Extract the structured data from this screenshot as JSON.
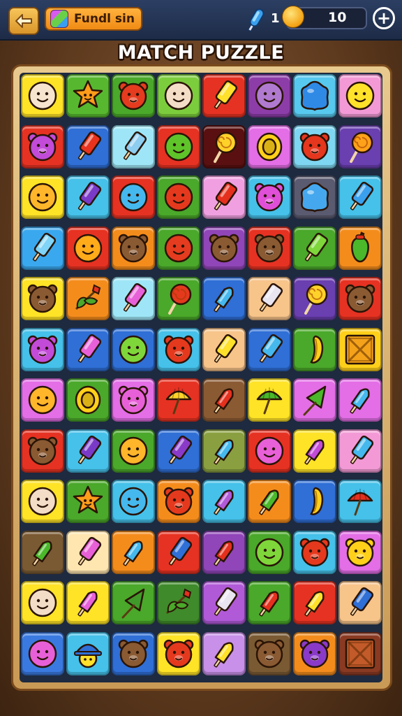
{
  "header": {
    "level_label": "Fundl sin",
    "rocket_count": "1",
    "coin_count": "10",
    "plus_symbol": "+"
  },
  "title": "MATCH PUZZLE",
  "board": {
    "rows": [
      [
        {
          "bg": "#ffe326",
          "icon": "face",
          "color": "#f6e4cf"
        },
        {
          "bg": "#57b82f",
          "icon": "star",
          "color": "#ff9c1a"
        },
        {
          "bg": "#4aa82a",
          "icon": "bear",
          "color": "#e53b1f"
        },
        {
          "bg": "#7ccd3d",
          "icon": "face",
          "color": "#f3ddc7"
        },
        {
          "bg": "#e63222",
          "icon": "pop",
          "color": "#ffe02a"
        },
        {
          "bg": "#8d3da8",
          "icon": "face",
          "color": "#b07ad0"
        },
        {
          "bg": "#57c8ee",
          "icon": "gem",
          "color": "#2f8ae6"
        },
        {
          "bg": "#f39ad6",
          "icon": "face",
          "color": "#ffe22a"
        }
      ],
      [
        {
          "bg": "#e63222",
          "icon": "bear",
          "color": "#c24bd8"
        },
        {
          "bg": "#2f6fd6",
          "icon": "pop",
          "color": "#e8331e"
        },
        {
          "bg": "#9ee6f7",
          "icon": "pop",
          "color": "#8ccdf0"
        },
        {
          "bg": "#e63222",
          "icon": "face",
          "color": "#5ec42a"
        },
        {
          "bg": "#5a1010",
          "icon": "lolly",
          "color": "#ffd22a"
        },
        {
          "bg": "#e36ee6",
          "icon": "ring",
          "color": "#ffd01a"
        },
        {
          "bg": "#7ed6f2",
          "icon": "bear",
          "color": "#e5361e"
        },
        {
          "bg": "#6a3fb0",
          "icon": "lolly",
          "color": "#ffa21a"
        }
      ],
      [
        {
          "bg": "#ffe326",
          "icon": "face",
          "color": "#ffb62a"
        },
        {
          "bg": "#45c1ea",
          "icon": "pop",
          "color": "#7a3ac8"
        },
        {
          "bg": "#e63222",
          "icon": "face",
          "color": "#45b8ee"
        },
        {
          "bg": "#4aa82a",
          "icon": "face",
          "color": "#e5391e"
        },
        {
          "bg": "#f0a0e0",
          "icon": "pop",
          "color": "#e5301e"
        },
        {
          "bg": "#45c1ea",
          "icon": "bear",
          "color": "#e04fd8"
        },
        {
          "bg": "#5a5a70",
          "icon": "gem",
          "color": "#45a8ee"
        },
        {
          "bg": "#45c1ea",
          "icon": "pop",
          "color": "#3aa0ee"
        }
      ],
      [
        {
          "bg": "#3aa8ee",
          "icon": "pop",
          "color": "#7fd4f7"
        },
        {
          "bg": "#e63222",
          "icon": "face",
          "color": "#ffab1a"
        },
        {
          "bg": "#f48c1c",
          "icon": "bear",
          "color": "#8a5a33"
        },
        {
          "bg": "#4aa82a",
          "icon": "face",
          "color": "#e53b1f"
        },
        {
          "bg": "#9045b8",
          "icon": "bear",
          "color": "#8a5a33"
        },
        {
          "bg": "#e63222",
          "icon": "bear",
          "color": "#8a5a33"
        },
        {
          "bg": "#4aa82a",
          "icon": "pop",
          "color": "#7ed63a"
        },
        {
          "bg": "#f48c1c",
          "icon": "pepper",
          "color": "#4ab82a"
        }
      ],
      [
        {
          "bg": "#ffe326",
          "icon": "bear",
          "color": "#8a5a33"
        },
        {
          "bg": "#f48c1c",
          "icon": "leaf",
          "color": "#4aa82a"
        },
        {
          "bg": "#9ee6f7",
          "icon": "pop",
          "color": "#e860d8"
        },
        {
          "bg": "#4aa82a",
          "icon": "lolly",
          "color": "#e5391e"
        },
        {
          "bg": "#2f6fd6",
          "icon": "rocketpop",
          "color": "#45b8ee"
        },
        {
          "bg": "#f7c48a",
          "icon": "pop",
          "color": "#e8e4f0"
        },
        {
          "bg": "#6a3fb0",
          "icon": "lolly",
          "color": "#ffd22a"
        },
        {
          "bg": "#e63222",
          "icon": "bear",
          "color": "#8a5a33"
        }
      ],
      [
        {
          "bg": "#45c1ea",
          "icon": "bear",
          "color": "#c24bd8"
        },
        {
          "bg": "#2f6fd6",
          "icon": "pop",
          "color": "#e860d8"
        },
        {
          "bg": "#2f6fd6",
          "icon": "face",
          "color": "#7ed63a"
        },
        {
          "bg": "#45c1ea",
          "icon": "bear",
          "color": "#e5391e"
        },
        {
          "bg": "#f7c48a",
          "icon": "pop",
          "color": "#ffe02a"
        },
        {
          "bg": "#2f6fd6",
          "icon": "pop",
          "color": "#45b8ee"
        },
        {
          "bg": "#4aa82a",
          "icon": "banana",
          "color": "#ffd01a"
        },
        {
          "bg": "#ffd01a",
          "icon": "crate",
          "color": "#f4a21a"
        }
      ],
      [
        {
          "bg": "#e36ee6",
          "icon": "face",
          "color": "#ffb62a"
        },
        {
          "bg": "#4aa82a",
          "icon": "ring",
          "color": "#ffd01a"
        },
        {
          "bg": "#e36ee6",
          "icon": "bear",
          "color": "#e860d8"
        },
        {
          "bg": "#e63222",
          "icon": "umbrella",
          "color": "#ffd22a"
        },
        {
          "bg": "#8a5a33",
          "icon": "rocketpop",
          "color": "#e5301e"
        },
        {
          "bg": "#ffe326",
          "icon": "umbrella",
          "color": "#4ab82a"
        },
        {
          "bg": "#e36ee6",
          "icon": "cone",
          "color": "#4ab82a"
        },
        {
          "bg": "#e36ee6",
          "icon": "rocketpop",
          "color": "#45b8ee"
        }
      ],
      [
        {
          "bg": "#e63222",
          "icon": "bear",
          "color": "#8a5a33"
        },
        {
          "bg": "#45c1ea",
          "icon": "pop",
          "color": "#7a3ac8"
        },
        {
          "bg": "#4aa82a",
          "icon": "face",
          "color": "#ffb62a"
        },
        {
          "bg": "#2f6fd6",
          "icon": "pop",
          "color": "#8a3ac8"
        },
        {
          "bg": "#8aa040",
          "icon": "rocketpop",
          "color": "#45b8ee"
        },
        {
          "bg": "#e63222",
          "icon": "face",
          "color": "#e860d8"
        },
        {
          "bg": "#ffe326",
          "icon": "rocketpop",
          "color": "#c24bd8"
        },
        {
          "bg": "#f39ad6",
          "icon": "pop",
          "color": "#45b8ee"
        }
      ],
      [
        {
          "bg": "#ffe326",
          "icon": "face",
          "color": "#f3ddc7"
        },
        {
          "bg": "#4aa82a",
          "icon": "star",
          "color": "#ff9c1a"
        },
        {
          "bg": "#45c1ea",
          "icon": "face",
          "color": "#45b8ee"
        },
        {
          "bg": "#f48c1c",
          "icon": "bear",
          "color": "#e5391e"
        },
        {
          "bg": "#45c1ea",
          "icon": "rocketpop",
          "color": "#b05ad8"
        },
        {
          "bg": "#f48c1c",
          "icon": "rocketpop",
          "color": "#4ab82a"
        },
        {
          "bg": "#2f6fd6",
          "icon": "banana",
          "color": "#ffd01a"
        },
        {
          "bg": "#45c1ea",
          "icon": "umbrella",
          "color": "#e5301e"
        }
      ],
      [
        {
          "bg": "#7a5a33",
          "icon": "rocketpop",
          "color": "#4ab82a"
        },
        {
          "bg": "#ffe6b0",
          "icon": "pop",
          "color": "#e860d8"
        },
        {
          "bg": "#f48c1c",
          "icon": "rocketpop",
          "color": "#45b8ee"
        },
        {
          "bg": "#e63222",
          "icon": "pop",
          "color": "#2f6fd6"
        },
        {
          "bg": "#9045b8",
          "icon": "rocketpop",
          "color": "#e5301e"
        },
        {
          "bg": "#4aa82a",
          "icon": "face",
          "color": "#7ed63a"
        },
        {
          "bg": "#45c1ea",
          "icon": "bear",
          "color": "#e5391e"
        },
        {
          "bg": "#e36ee6",
          "icon": "bear",
          "color": "#ffd01a"
        }
      ],
      [
        {
          "bg": "#ffe326",
          "icon": "face",
          "color": "#f3ddc7"
        },
        {
          "bg": "#ffe326",
          "icon": "rocketpop",
          "color": "#e860d8"
        },
        {
          "bg": "#4aa82a",
          "icon": "cone",
          "color": "#3f9a2a"
        },
        {
          "bg": "#3f8a2a",
          "icon": "leaf",
          "color": "#4aa82a"
        },
        {
          "bg": "#b05ad8",
          "icon": "pop",
          "color": "#e8e4f0"
        },
        {
          "bg": "#4aa82a",
          "icon": "rocketpop",
          "color": "#e5301e"
        },
        {
          "bg": "#e63222",
          "icon": "rocketpop",
          "color": "#ffe02a"
        },
        {
          "bg": "#f7c48a",
          "icon": "pop",
          "color": "#2f6fd6"
        }
      ],
      [
        {
          "bg": "#3a7ae0",
          "icon": "face",
          "color": "#e860d8"
        },
        {
          "bg": "#45c1ea",
          "icon": "hat",
          "color": "#2f6fd6"
        },
        {
          "bg": "#2f6fd6",
          "icon": "bear",
          "color": "#8a5a33"
        },
        {
          "bg": "#ffe326",
          "icon": "bear",
          "color": "#e5391e"
        },
        {
          "bg": "#c890e8",
          "icon": "rocketpop",
          "color": "#ffe02a"
        },
        {
          "bg": "#7a5a33",
          "icon": "bear",
          "color": "#8a5a33"
        },
        {
          "bg": "#f48c1c",
          "icon": "bear",
          "color": "#8a3ac8"
        },
        {
          "bg": "#8a3a22",
          "icon": "crate",
          "color": "#c25a2a"
        }
      ]
    ]
  }
}
